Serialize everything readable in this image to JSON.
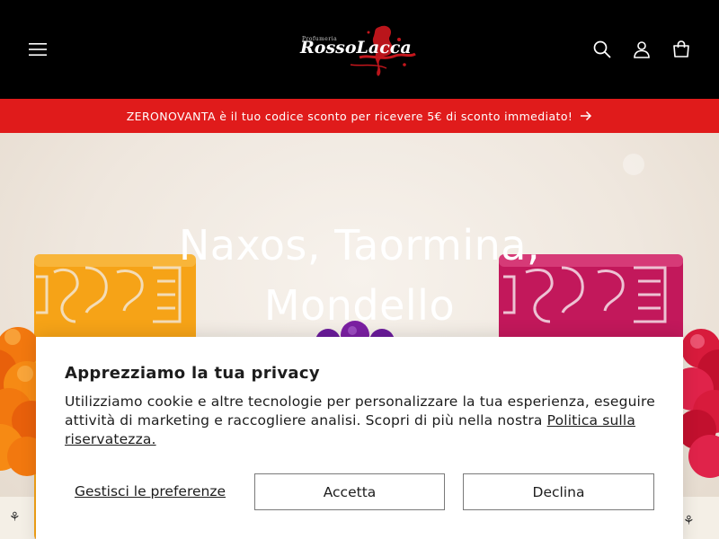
{
  "header": {
    "logo": {
      "small_text": "Profumeria",
      "brand_text": "RossoLacca"
    },
    "icons": {
      "menu": "hamburger-menu-icon",
      "search": "search-icon",
      "account": "account-icon",
      "cart": "cart-icon"
    }
  },
  "announcement": {
    "text": "ZERONOVANTA è il tuo codice sconto per ricevere 5€ di sconto immediato!",
    "icon": "arrow-right-icon"
  },
  "hero": {
    "title": "Naxos, Taormina, Mondello"
  },
  "cookie_banner": {
    "title": "Apprezziamo la tua privacy",
    "body": "Utilizziamo cookie e altre tecnologie per personalizzare la tua esperienza, eseguire attività di marketing e raccogliere analisi. Scopri di più nella nostra ",
    "link_text": "Politica sulla riservatezza.",
    "manage_label": "Gestisci le preferenze",
    "accept_label": "Accetta",
    "decline_label": "Declina"
  },
  "colors": {
    "header_bg": "#000000",
    "announcement_bg": "#e01b1b",
    "brand_red": "#c4161c",
    "orange_product": "#f39c12",
    "pink_product": "#c2185b",
    "purple_product": "#6a1b9a"
  }
}
